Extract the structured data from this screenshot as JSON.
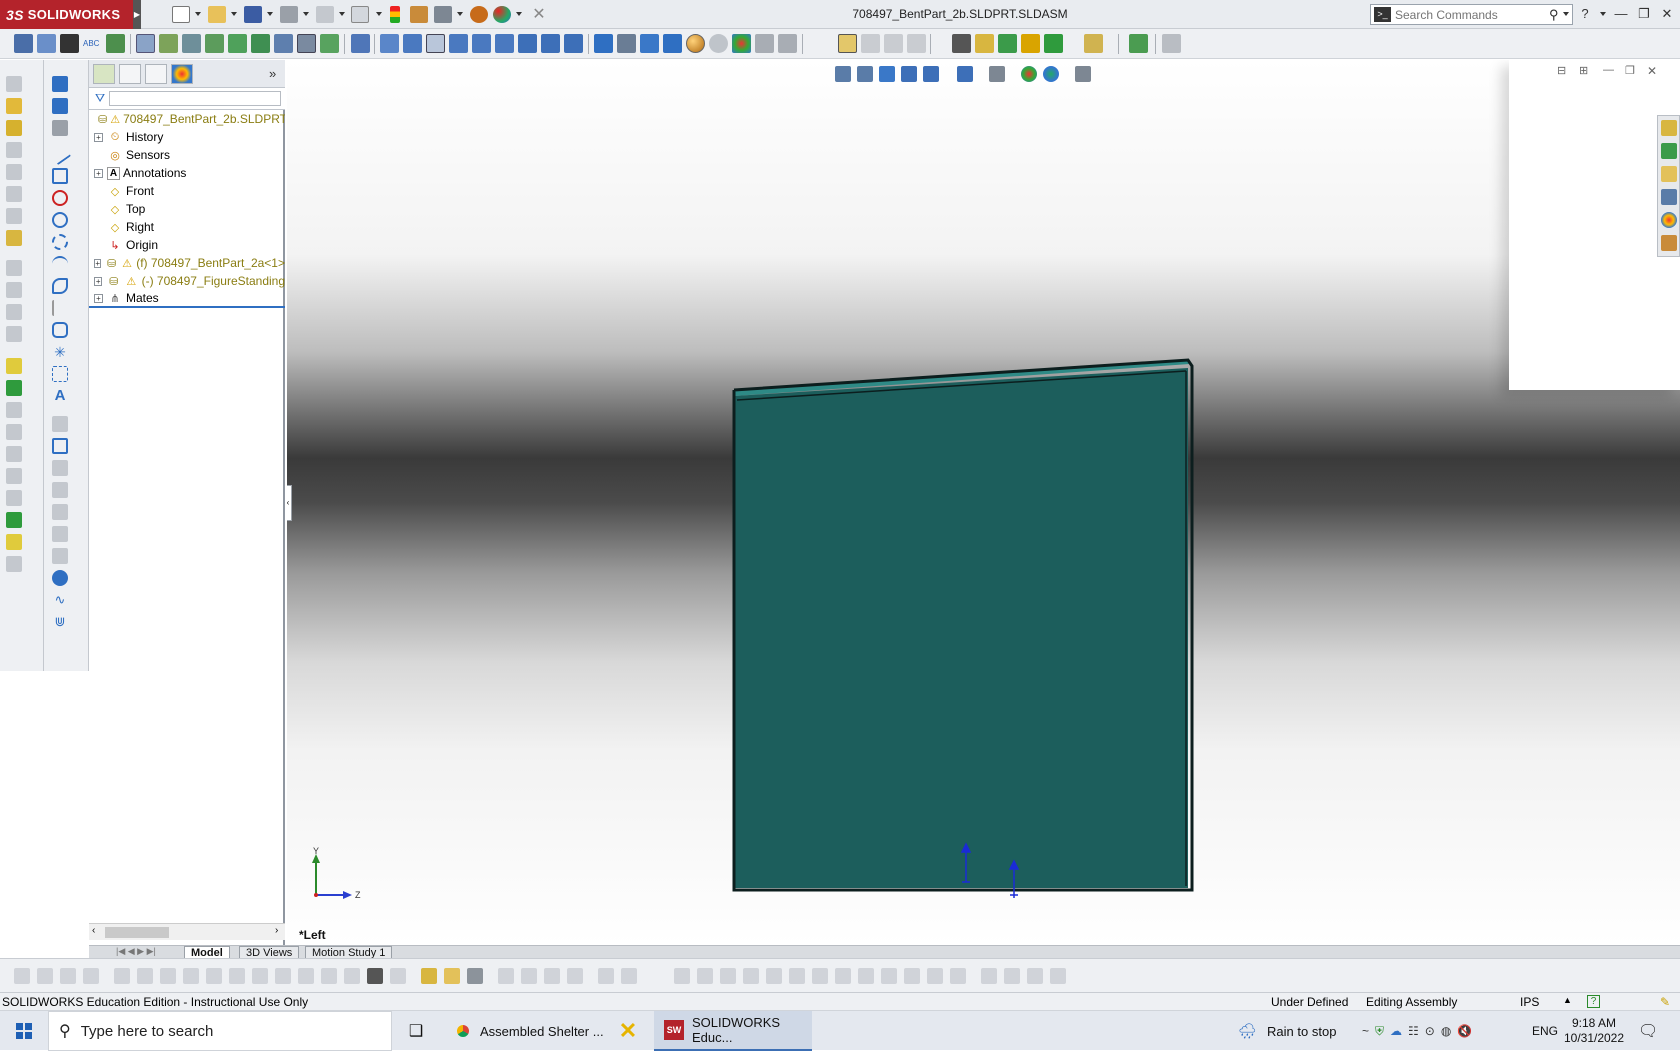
{
  "app": {
    "brand": "SOLIDWORKS",
    "brand_prefix": "3S",
    "document_title": "708497_BentPart_2b.SLDPRT.SLDASM",
    "search_placeholder": "Search Commands"
  },
  "feature_tree": {
    "root": "708497_BentPart_2b.SLDPRT  (",
    "items": [
      {
        "label": "History",
        "icon": "history-icon"
      },
      {
        "label": "Sensors",
        "icon": "sensors-icon"
      },
      {
        "label": "Annotations",
        "icon": "annotations-icon"
      },
      {
        "label": "Front",
        "icon": "plane-icon"
      },
      {
        "label": "Top",
        "icon": "plane-icon"
      },
      {
        "label": "Right",
        "icon": "plane-icon"
      },
      {
        "label": "Origin",
        "icon": "origin-icon"
      },
      {
        "label": "(f) 708497_BentPart_2a<1>",
        "icon": "part-warning-icon"
      },
      {
        "label": "(-) 708497_FigureStanding",
        "icon": "part-warning-icon"
      },
      {
        "label": "Mates",
        "icon": "mates-icon"
      }
    ]
  },
  "viewport": {
    "view_label": "*Left",
    "axis_y": "Y",
    "axis_z": "Z",
    "part_color": "#1c5e5c",
    "part_edge_color": "#0c1e1e"
  },
  "bottom_tabs": {
    "model": "Model",
    "views_3d": "3D Views",
    "motion": "Motion Study 1"
  },
  "status_bar": {
    "edition": "SOLIDWORKS Education Edition - Instructional Use Only",
    "definition": "Under Defined",
    "mode": "Editing Assembly",
    "units": "IPS"
  },
  "taskbar": {
    "search_placeholder": "Type here to search",
    "apps": [
      {
        "label": "Assembled Shelter ...",
        "icon": "chrome-icon"
      },
      {
        "label": "",
        "icon": "x-app-icon"
      },
      {
        "label": "SOLIDWORKS Educ...",
        "icon": "solidworks-icon"
      }
    ],
    "weather": "Rain to stop",
    "language": "ENG",
    "time": "9:18 AM",
    "date": "10/31/2022"
  }
}
